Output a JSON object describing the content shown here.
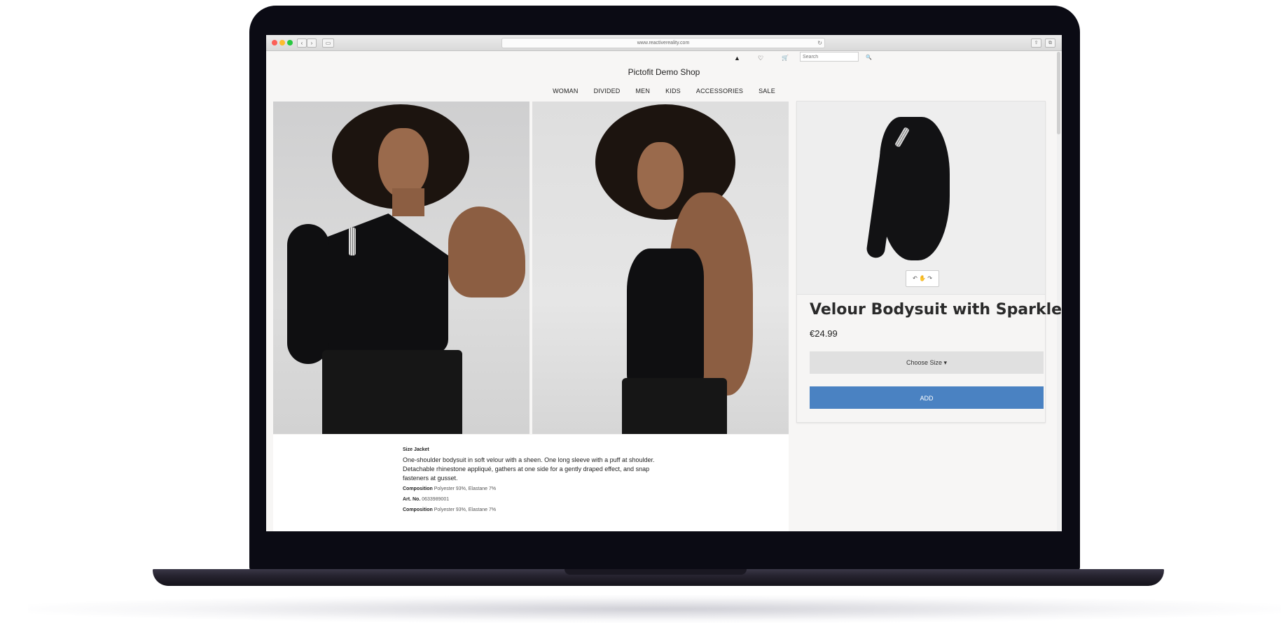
{
  "browser": {
    "url": "www.reactivereality.com",
    "back_glyph": "‹",
    "forward_glyph": "›",
    "sidebar_glyph": "▭",
    "reload_glyph": "↻",
    "share_glyph": "⇪",
    "tabs_glyph": "⧉"
  },
  "header": {
    "shop_title": "Pictofit Demo Shop",
    "search_placeholder": "Search",
    "icons": {
      "account": "person-icon",
      "wishlist": "heart-icon",
      "cart": "cart-icon",
      "search": "search-icon"
    },
    "account_glyph": "▲",
    "wishlist_glyph": "♡",
    "cart_glyph": "🛒",
    "search_glyph": "🔍"
  },
  "nav": {
    "items": [
      {
        "label": "WOMAN"
      },
      {
        "label": "DIVIDED"
      },
      {
        "label": "MEN"
      },
      {
        "label": "KIDS"
      },
      {
        "label": "ACCESSORIES"
      },
      {
        "label": "SALE"
      }
    ]
  },
  "product": {
    "title": "Velour Bodysuit with Sparkles",
    "price": "€24.99",
    "size_label": "Choose Size ▾",
    "add_label": "ADD",
    "rotate_glyph": "↶ ✋ ↷"
  },
  "description": {
    "heading": "Size Jacket",
    "text": "One-shoulder bodysuit in soft velour with a sheen. One long sleeve with a puff at shoulder. Detachable rhinestone appliqué, gathers at one side for a gently draped effect, and snap fasteners at gusset.",
    "composition_label": "Composition",
    "composition_value": "Polyester 93%, Elastane 7%",
    "art_label": "Art. No.",
    "art_value": "0633989001",
    "composition2_label": "Composition",
    "composition2_value": "Polyester 93%, Elastane 7%"
  },
  "colors": {
    "accent": "#4a82c2",
    "bezel": "#0b0b14"
  }
}
